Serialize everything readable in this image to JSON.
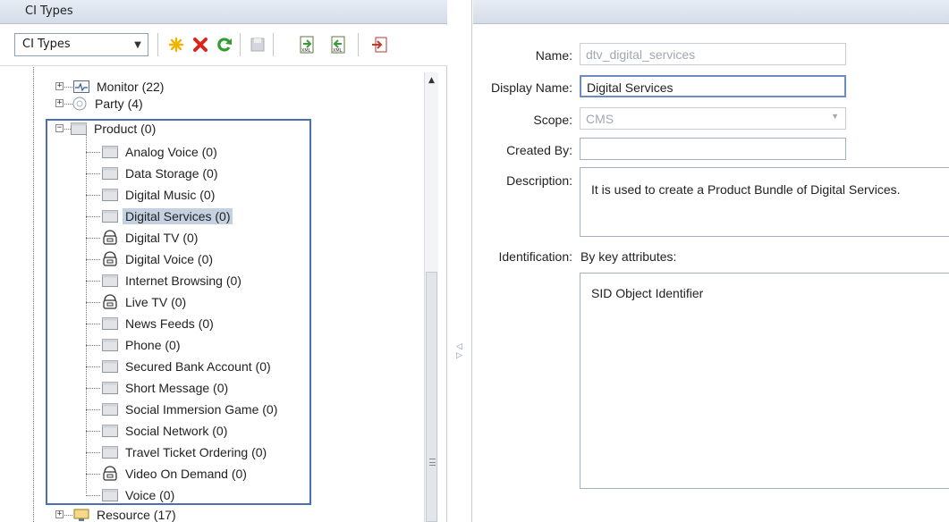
{
  "left_panel": {
    "title": "CI Types",
    "selector_value": "CI Types"
  },
  "toolbar": {
    "icons": [
      "new-icon",
      "delete-icon",
      "refresh-icon",
      "save-icon",
      "export-xml-icon",
      "import-xml-icon",
      "export-icon"
    ]
  },
  "tree": {
    "top_items": [
      {
        "label": "Monitor (22)",
        "icon": "monitor-icon"
      },
      {
        "label": "Party (4)",
        "icon": "party-icon"
      },
      {
        "label": "Product (0)",
        "icon": "folder-icon"
      }
    ],
    "children": [
      {
        "label": "Analog Voice (0)",
        "icon": "folder-icon"
      },
      {
        "label": "Data Storage (0)",
        "icon": "folder-icon"
      },
      {
        "label": "Digital Music (0)",
        "icon": "folder-icon"
      },
      {
        "label": "Digital Services (0)",
        "icon": "folder-icon",
        "selected": true
      },
      {
        "label": "Digital TV (0)",
        "icon": "bundle-icon"
      },
      {
        "label": "Digital Voice (0)",
        "icon": "bundle-icon"
      },
      {
        "label": "Internet Browsing (0)",
        "icon": "folder-icon"
      },
      {
        "label": "Live TV (0)",
        "icon": "bundle-icon"
      },
      {
        "label": "News Feeds (0)",
        "icon": "folder-icon"
      },
      {
        "label": "Phone (0)",
        "icon": "folder-icon"
      },
      {
        "label": "Secured Bank Account (0)",
        "icon": "folder-icon"
      },
      {
        "label": "Short Message (0)",
        "icon": "folder-icon"
      },
      {
        "label": "Social Immersion Game (0)",
        "icon": "folder-icon"
      },
      {
        "label": "Social Network (0)",
        "icon": "folder-icon"
      },
      {
        "label": "Travel Ticket Ordering (0)",
        "icon": "folder-icon"
      },
      {
        "label": "Video On Demand (0)",
        "icon": "bundle-icon"
      },
      {
        "label": "Voice (0)",
        "icon": "folder-icon"
      }
    ],
    "bottom_item": {
      "label": "Resource (17)",
      "icon": "resource-icon"
    }
  },
  "form": {
    "name_label": "Name:",
    "name_value": "dtv_digital_services",
    "display_name_label": "Display Name:",
    "display_name_value": "Digital Services",
    "scope_label": "Scope:",
    "scope_value": "CMS",
    "created_by_label": "Created By:",
    "created_by_value": "",
    "description_label": "Description:",
    "description_value": "It is used to create a Product Bundle of Digital Services.",
    "identification_label": "Identification:",
    "identification_value": "By key attributes:",
    "key_attribute": "SID Object Identifier"
  }
}
